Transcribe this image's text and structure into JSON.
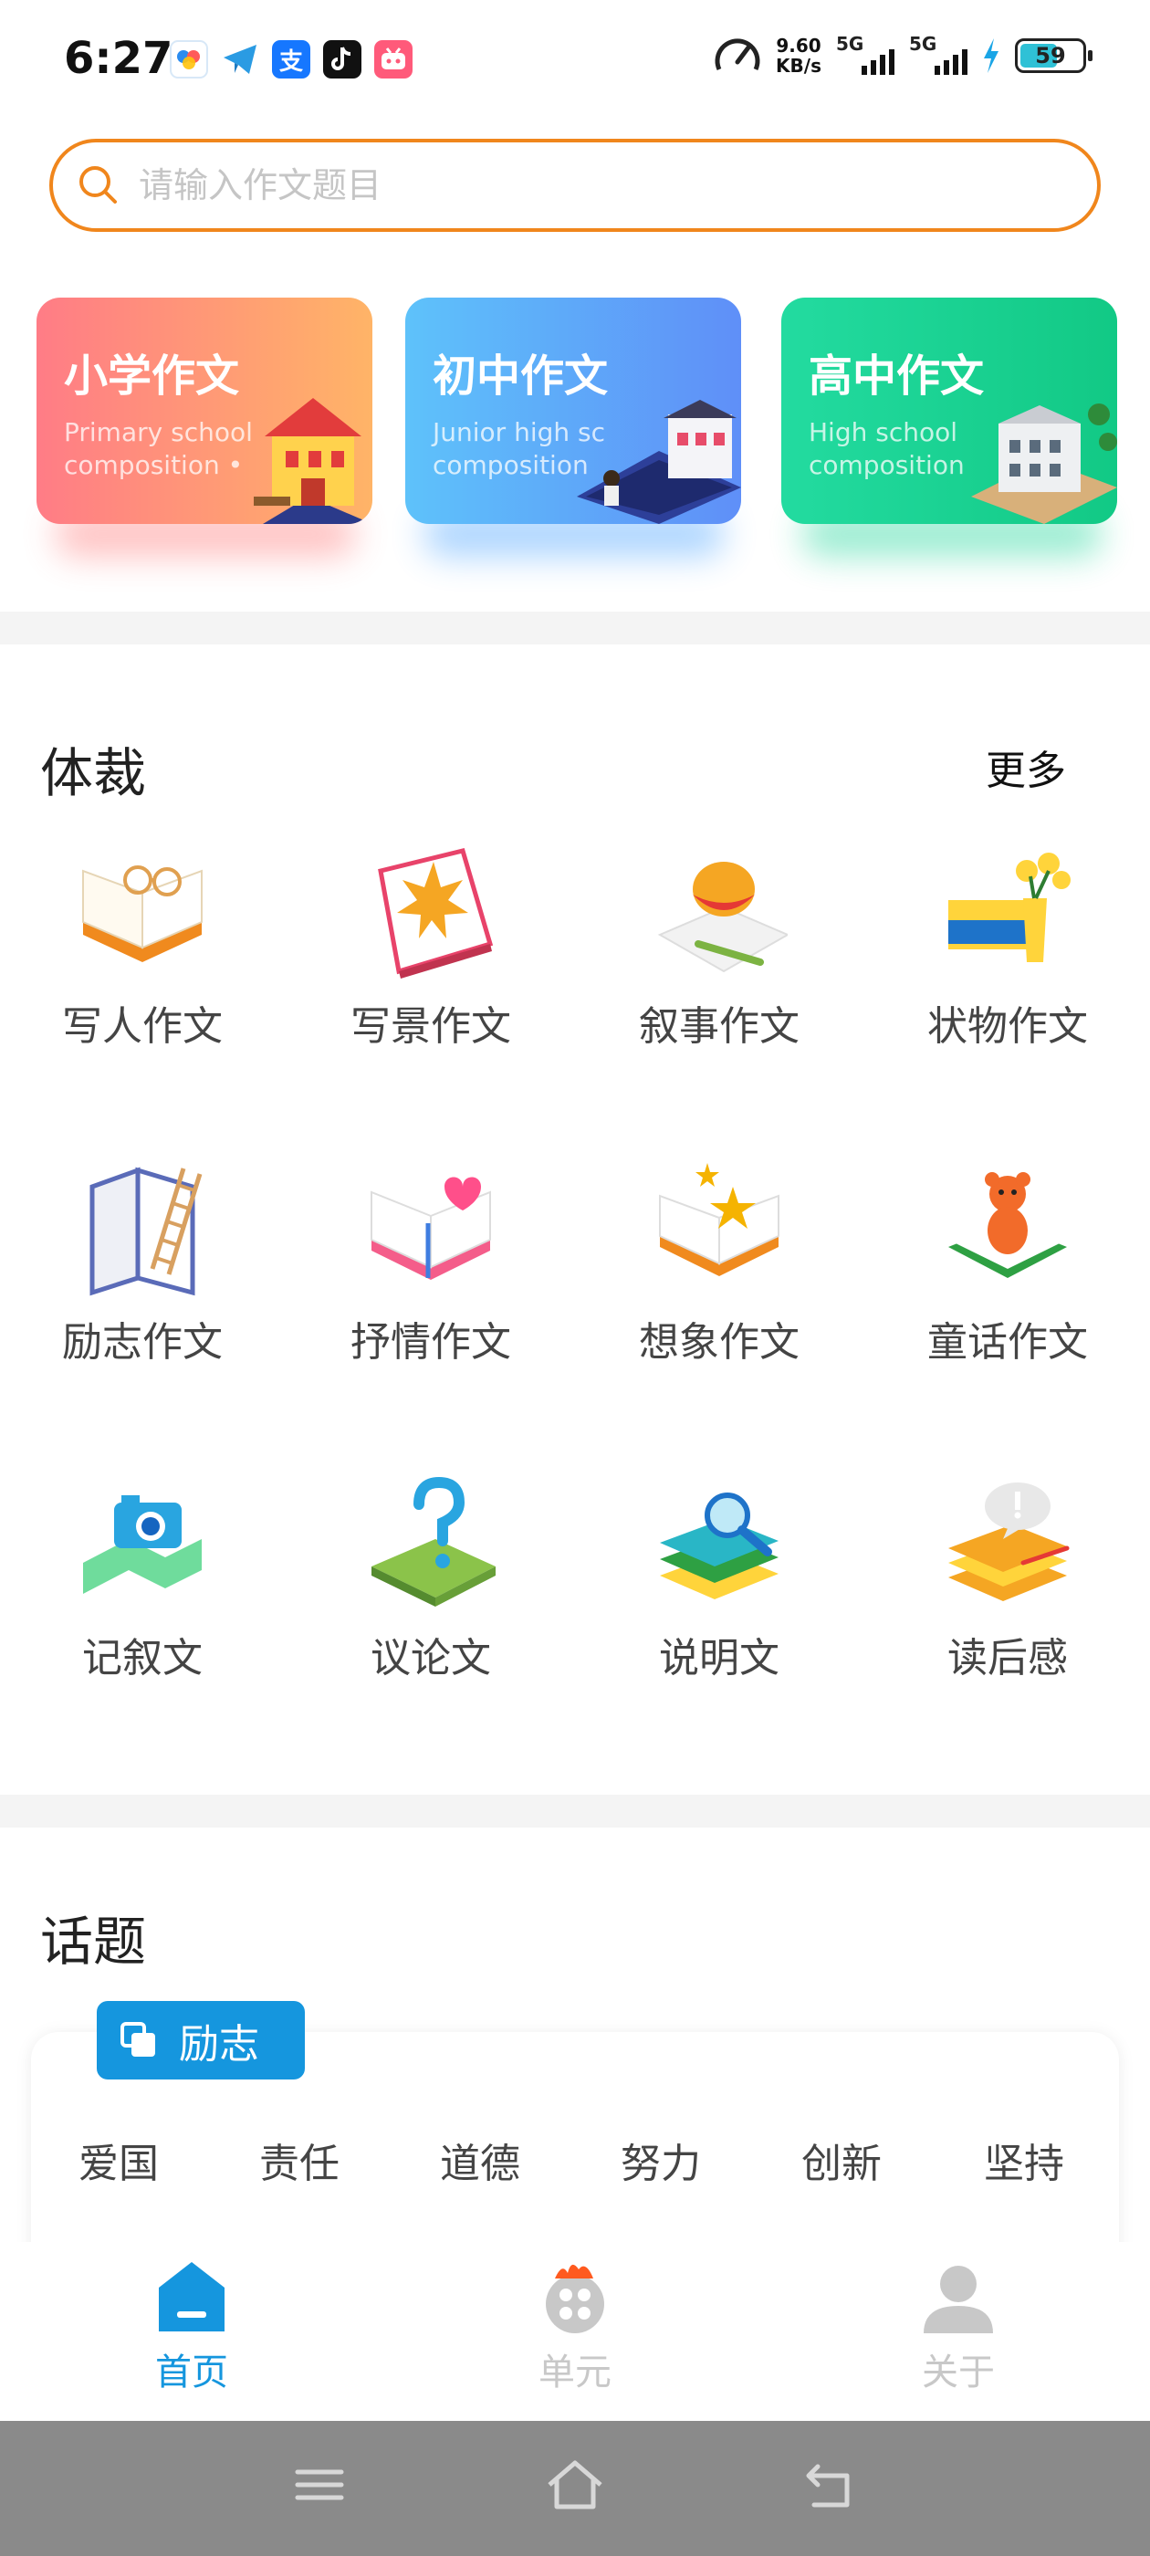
{
  "status_bar": {
    "time": "6:27",
    "net_speed_value": "9.60",
    "net_speed_unit": "KB/s",
    "signal_1": "5G",
    "signal_2": "5G",
    "battery": "59",
    "app_icons": [
      "baidu-netdisk-icon",
      "telegram-icon",
      "alipay-icon",
      "tiktok-icon",
      "bilibili-icon"
    ]
  },
  "search": {
    "placeholder": "请输入作文题目",
    "value": ""
  },
  "grade_cards": [
    {
      "title": "小学作文",
      "subtitle_line1": "Primary school",
      "subtitle_line2": "composition •"
    },
    {
      "title": "初中作文",
      "subtitle_line1": "Junior high sc",
      "subtitle_line2": "composition"
    },
    {
      "title": "高中作文",
      "subtitle_line1": "High school",
      "subtitle_line2": "composition"
    }
  ],
  "genre_section": {
    "title": "体裁",
    "more_label": "更多",
    "items": [
      "写人作文",
      "写景作文",
      "叙事作文",
      "状物作文",
      "励志作文",
      "抒情作文",
      "想象作文",
      "童话作文",
      "记叙文",
      "议论文",
      "说明文",
      "读后感"
    ]
  },
  "topic_section": {
    "title": "话题",
    "badge": "励志",
    "topics": [
      "爱国",
      "责任",
      "道德",
      "努力",
      "创新",
      "坚持"
    ]
  },
  "bottom_nav": {
    "home": "首页",
    "unit": "单元",
    "about": "关于",
    "active_color": "#1596de",
    "inactive_color": "#c8c8c8"
  },
  "colors": {
    "accent_orange": "#f0861c",
    "badge_blue": "#1596de"
  }
}
